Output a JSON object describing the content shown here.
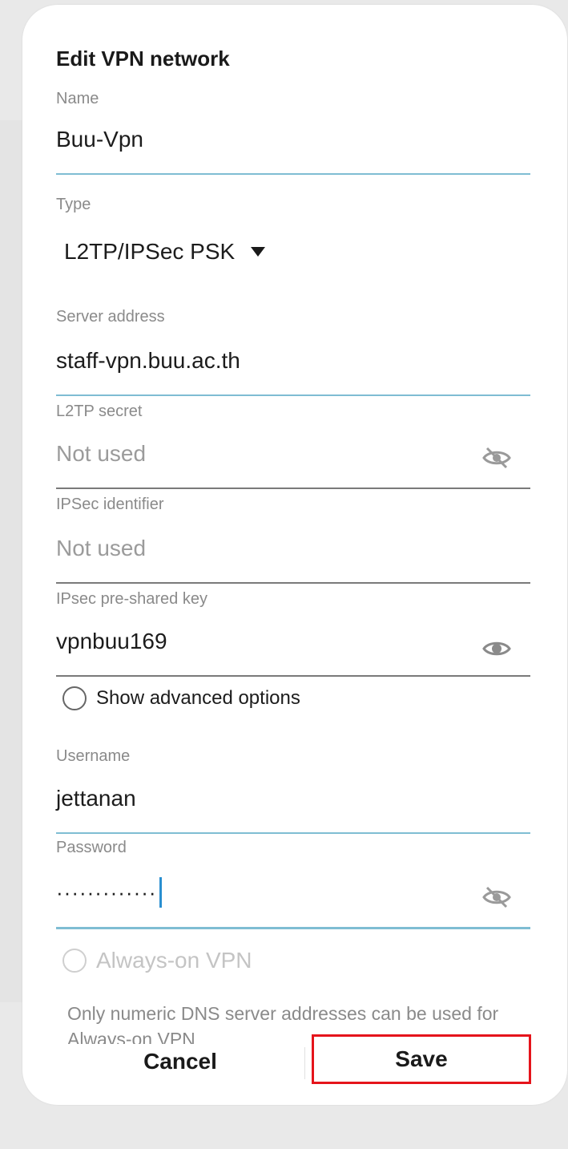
{
  "dialog": {
    "title": "Edit VPN network",
    "fields": {
      "name": {
        "label": "Name",
        "value": "Buu-Vpn"
      },
      "type": {
        "label": "Type",
        "value": "L2TP/IPSec PSK"
      },
      "server": {
        "label": "Server address",
        "value": "staff-vpn.buu.ac.th"
      },
      "l2tp_secret": {
        "label": "L2TP secret",
        "placeholder": "Not used"
      },
      "ipsec_identifier": {
        "label": "IPSec identifier",
        "placeholder": "Not used"
      },
      "ipsec_psk": {
        "label": "IPsec pre-shared key",
        "value": "vpnbuu169"
      },
      "advanced": {
        "label": "Show advanced options"
      },
      "username": {
        "label": "Username",
        "value": "jettanan"
      },
      "password": {
        "label": "Password",
        "value": "·············"
      },
      "always_on": {
        "label": "Always-on VPN"
      },
      "note": "Only numeric DNS server addresses can be used for Always-on VPN"
    },
    "buttons": {
      "cancel": "Cancel",
      "save": "Save"
    }
  },
  "colors": {
    "accent_line": "#7fbdd3",
    "highlight_box": "#e5141b",
    "cursor": "#2a8fd0"
  },
  "icons": {
    "hidden_eye": "eye-off-icon",
    "visible_eye": "eye-icon",
    "dropdown": "caret-down-icon"
  }
}
